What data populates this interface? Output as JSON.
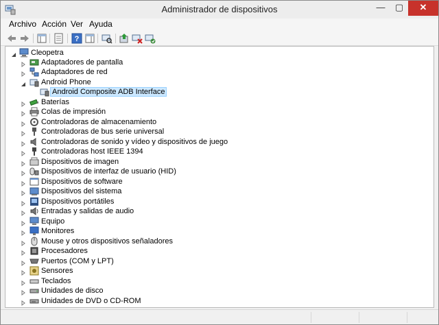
{
  "window": {
    "title": "Administrador de dispositivos",
    "minimize_label": "—",
    "maximize_label": "▢",
    "close_label": "✕"
  },
  "menu": [
    "Archivo",
    "Acción",
    "Ver",
    "Ayuda"
  ],
  "toolbar": {
    "icons": [
      "back-icon",
      "forward-icon",
      "show-hide-console-tree-icon",
      "properties-icon",
      "help-icon",
      "action-pane-icon",
      "scan-hardware-icon",
      "update-driver-icon",
      "disable-device-icon",
      "uninstall-device-icon"
    ]
  },
  "tree": {
    "root": "Cleopetra",
    "categories": [
      {
        "label": "Adaptadores de pantalla",
        "icon": "display-adapter-icon",
        "expanded": false
      },
      {
        "label": "Adaptadores de red",
        "icon": "network-adapter-icon",
        "expanded": false
      },
      {
        "label": "Android Phone",
        "icon": "android-phone-icon",
        "expanded": true,
        "children": [
          "Android Composite ADB Interface"
        ]
      },
      {
        "label": "Baterías",
        "icon": "battery-icon",
        "expanded": false
      },
      {
        "label": "Colas de impresión",
        "icon": "printer-icon",
        "expanded": false
      },
      {
        "label": "Controladoras de almacenamiento",
        "icon": "storage-controller-icon",
        "expanded": false
      },
      {
        "label": "Controladoras de bus serie universal",
        "icon": "usb-icon",
        "expanded": false
      },
      {
        "label": "Controladoras de sonido y vídeo y dispositivos de juego",
        "icon": "sound-icon",
        "expanded": false
      },
      {
        "label": "Controladoras host IEEE 1394",
        "icon": "ieee1394-icon",
        "expanded": false
      },
      {
        "label": "Dispositivos de imagen",
        "icon": "imaging-device-icon",
        "expanded": false
      },
      {
        "label": "Dispositivos de interfaz de usuario (HID)",
        "icon": "hid-icon",
        "expanded": false
      },
      {
        "label": "Dispositivos de software",
        "icon": "software-device-icon",
        "expanded": false
      },
      {
        "label": "Dispositivos del sistema",
        "icon": "system-device-icon",
        "expanded": false
      },
      {
        "label": "Dispositivos portátiles",
        "icon": "portable-device-icon",
        "expanded": false
      },
      {
        "label": "Entradas y salidas de audio",
        "icon": "audio-io-icon",
        "expanded": false
      },
      {
        "label": "Equipo",
        "icon": "computer-icon",
        "expanded": false
      },
      {
        "label": "Monitores",
        "icon": "monitor-icon",
        "expanded": false
      },
      {
        "label": "Mouse y otros dispositivos señaladores",
        "icon": "mouse-icon",
        "expanded": false
      },
      {
        "label": "Procesadores",
        "icon": "processor-icon",
        "expanded": false
      },
      {
        "label": "Puertos (COM y LPT)",
        "icon": "port-icon",
        "expanded": false
      },
      {
        "label": "Sensores",
        "icon": "sensor-icon",
        "expanded": false
      },
      {
        "label": "Teclados",
        "icon": "keyboard-icon",
        "expanded": false
      },
      {
        "label": "Unidades de disco",
        "icon": "disk-drive-icon",
        "expanded": false
      },
      {
        "label": "Unidades de DVD o CD-ROM",
        "icon": "dvd-drive-icon",
        "expanded": false
      }
    ],
    "selected": "Android Composite ADB Interface"
  },
  "colors": {
    "selection_bg": "#cce8ff",
    "selection_border": "#99d1ff",
    "close_button": "#c7322b"
  }
}
